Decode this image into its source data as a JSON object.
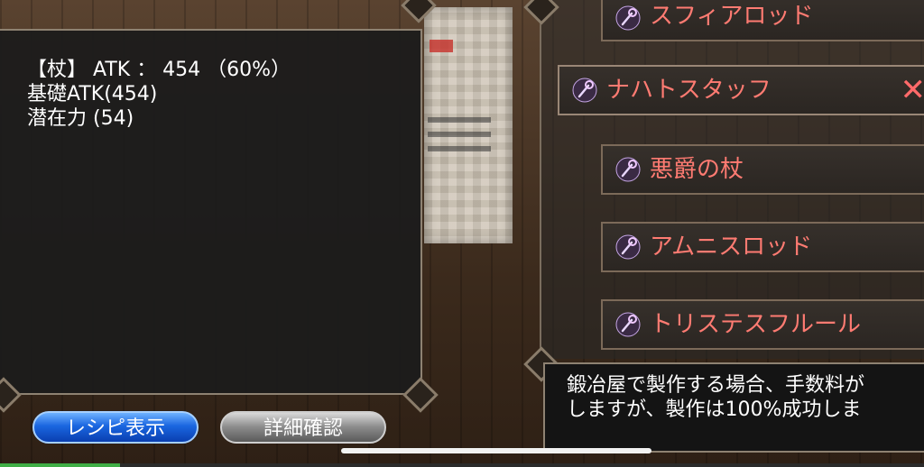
{
  "info": {
    "line1": "【杖】 ATK ： 454 （60%）",
    "line2": "基礎ATK(454)",
    "line3": "潜在力 (54)"
  },
  "buttons": {
    "recipe": "レシピ表示",
    "detail": "詳細確認"
  },
  "list": {
    "items": [
      {
        "label": "スフィアロッド",
        "icon": "staff-icon",
        "selected": false
      },
      {
        "label": "ナハトスタッフ",
        "icon": "staff-icon",
        "selected": true
      },
      {
        "label": "悪爵の杖",
        "icon": "staff-icon",
        "selected": false
      },
      {
        "label": "アムニスロッド",
        "icon": "staff-icon",
        "selected": false
      },
      {
        "label": "トリステスフルール",
        "icon": "staff-icon",
        "selected": false
      }
    ],
    "close_symbol": "✕"
  },
  "message": {
    "line1": "鍛冶屋で製作する場合、手数料が",
    "line2": "しますが、製作は100%成功しま"
  },
  "colors": {
    "item_text": "#ff7b72",
    "recipe_button": "#1a66e0",
    "detail_button": "#8a8a8a",
    "progress": "#3fae46"
  },
  "progress": {
    "fraction": 0.13
  }
}
